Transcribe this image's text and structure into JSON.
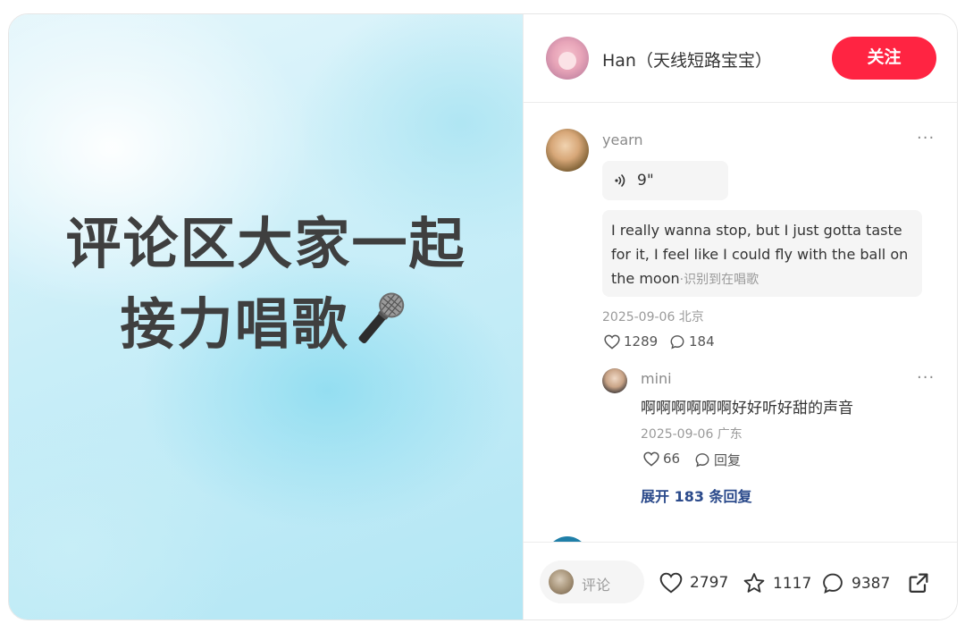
{
  "media": {
    "line1": "评论区大家一起",
    "line2": "接力唱歌"
  },
  "author": {
    "name": "Han（天线短路宝宝）",
    "follow_label": "关注"
  },
  "comment": {
    "username": "yearn",
    "voice_duration": "9\"",
    "transcript": "I really wanna stop, but I just gotta taste for it, I feel like I could fly with the ball on the moon",
    "recognized_label": "·识别到在唱歌",
    "meta": "2025-09-06 北京",
    "likes": "1289",
    "replies": "184"
  },
  "reply": {
    "username": "mini",
    "text": "啊啊啊啊啊啊好好听好甜的声音",
    "meta": "2025-09-06 广东",
    "likes": "66",
    "reply_label": "回复"
  },
  "expand_label": "展开 183 条回复",
  "bottom": {
    "comment_placeholder": "评论",
    "likes": "2797",
    "stars": "1117",
    "comments": "9387"
  },
  "icons": {
    "more": "more-dots-icon",
    "voice": "voice-wave-icon",
    "heart": "heart-icon",
    "comment": "comment-bubble-icon",
    "star": "star-icon",
    "share": "share-icon",
    "mic": "microphone-icon"
  },
  "colors": {
    "accent": "#ff2442",
    "link": "#2b4a8b"
  }
}
